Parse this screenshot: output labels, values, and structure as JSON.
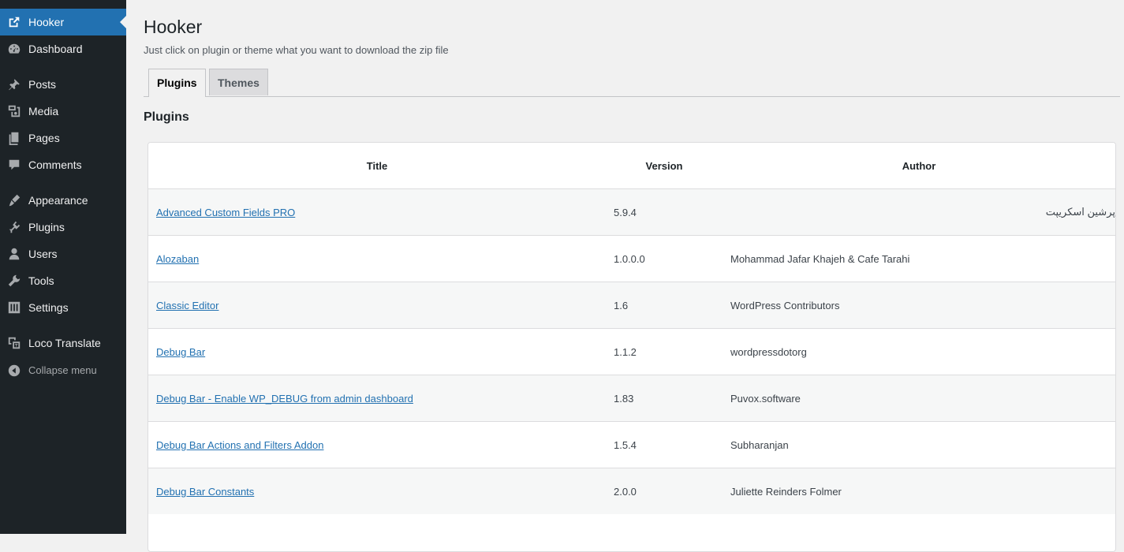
{
  "sidebar": {
    "items": [
      {
        "label": "Hooker",
        "icon": "external-link-icon",
        "active": true
      },
      {
        "label": "Dashboard",
        "icon": "dashboard-gauge-icon"
      },
      {
        "label": "Posts",
        "icon": "pushpin-icon"
      },
      {
        "label": "Media",
        "icon": "media-icon"
      },
      {
        "label": "Pages",
        "icon": "pages-icon"
      },
      {
        "label": "Comments",
        "icon": "comment-bubble-icon"
      },
      {
        "label": "Appearance",
        "icon": "paintbrush-icon"
      },
      {
        "label": "Plugins",
        "icon": "plug-icon"
      },
      {
        "label": "Users",
        "icon": "user-icon"
      },
      {
        "label": "Tools",
        "icon": "wrench-icon"
      },
      {
        "label": "Settings",
        "icon": "sliders-icon"
      },
      {
        "label": "Loco Translate",
        "icon": "translate-icon"
      }
    ],
    "collapse_label": "Collapse menu",
    "colors": {
      "background": "#1d2327",
      "active": "#2271b1",
      "text": "#f0f0f1"
    }
  },
  "main": {
    "title": "Hooker",
    "description": "Just click on plugin or theme what you want to download the zip file",
    "tabs": [
      {
        "label": "Plugins",
        "active": true
      },
      {
        "label": "Themes",
        "active": false
      }
    ],
    "section_title": "Plugins",
    "table": {
      "columns": [
        "Title",
        "Version",
        "Author"
      ],
      "rows": [
        {
          "title": "Advanced Custom Fields PRO",
          "version": "5.9.4",
          "author": "پرشین اسکریپت"
        },
        {
          "title": "Alozaban",
          "version": "1.0.0.0",
          "author": "Mohammad Jafar Khajeh & Cafe Tarahi"
        },
        {
          "title": "Classic Editor",
          "version": "1.6",
          "author": "WordPress Contributors"
        },
        {
          "title": "Debug Bar",
          "version": "1.1.2",
          "author": "wordpressdotorg"
        },
        {
          "title": "Debug Bar - Enable WP_DEBUG from admin dashboard",
          "version": "1.83",
          "author": "Puvox.software"
        },
        {
          "title": "Debug Bar Actions and Filters Addon",
          "version": "1.5.4",
          "author": "Subharanjan"
        },
        {
          "title": "Debug Bar Constants",
          "version": "2.0.0",
          "author": "Juliette Reinders Folmer"
        }
      ]
    },
    "colors": {
      "link": "#2271b1",
      "background": "#f1f1f1"
    }
  }
}
